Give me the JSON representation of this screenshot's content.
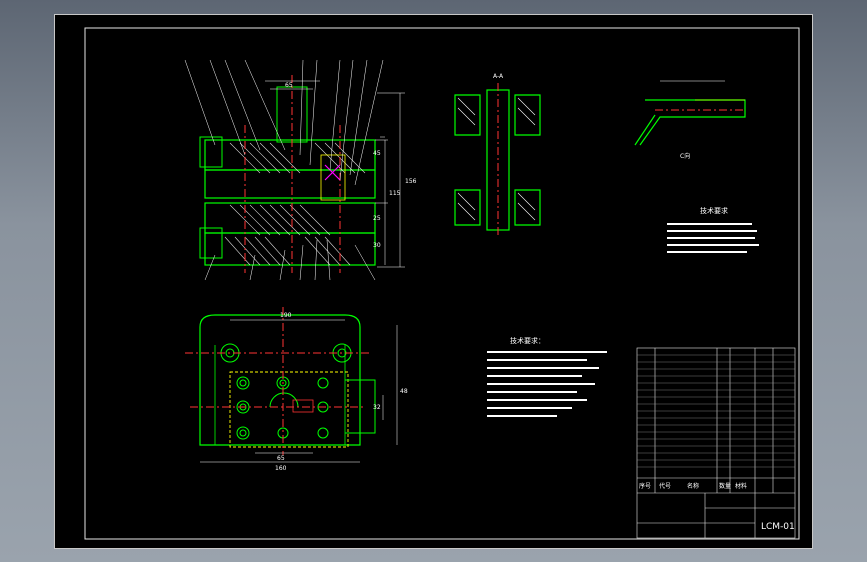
{
  "drawing": {
    "title_block": {
      "drawing_no": "LCM-01",
      "row_labels": [
        "序号",
        "代号",
        "名称",
        "数量",
        "材料"
      ]
    },
    "section_labels": [
      "A-A",
      "C向"
    ],
    "notes_title": "技术要求",
    "tech_notes_title": "技术要求：",
    "dim_labels": [
      "190",
      "160",
      "65",
      "65",
      "156",
      "115",
      "45",
      "48",
      "32",
      "25",
      "30"
    ]
  },
  "colors": {
    "outline": "#00ff00",
    "hatch": "#ffffff",
    "center": "#ff3333",
    "dim": "#ffffff",
    "part": "#ffff00",
    "accent": "#ff00ff"
  }
}
